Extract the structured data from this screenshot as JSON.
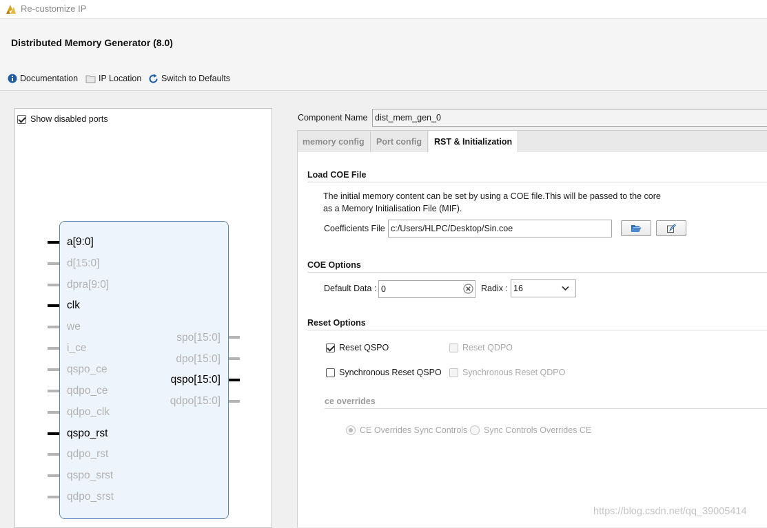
{
  "window": {
    "title": "Re-customize IP"
  },
  "header": {
    "ip_title": "Distributed Memory Generator (8.0)",
    "toolbar": {
      "documentation": "Documentation",
      "ip_location": "IP Location",
      "switch_defaults": "Switch to Defaults"
    }
  },
  "left_panel": {
    "show_disabled_ports": {
      "label": "Show disabled ports",
      "checked": true
    },
    "inputs": [
      {
        "name": "a[9:0]",
        "enabled": true
      },
      {
        "name": "d[15:0]",
        "enabled": false
      },
      {
        "name": "dpra[9:0]",
        "enabled": false
      },
      {
        "name": "clk",
        "enabled": true
      },
      {
        "name": "we",
        "enabled": false
      },
      {
        "name": "i_ce",
        "enabled": false
      },
      {
        "name": "qspo_ce",
        "enabled": false
      },
      {
        "name": "qdpo_ce",
        "enabled": false
      },
      {
        "name": "qdpo_clk",
        "enabled": false
      },
      {
        "name": "qspo_rst",
        "enabled": true
      },
      {
        "name": "qdpo_rst",
        "enabled": false
      },
      {
        "name": "qspo_srst",
        "enabled": false
      },
      {
        "name": "qdpo_srst",
        "enabled": false
      }
    ],
    "outputs": [
      {
        "name": "spo[15:0]",
        "enabled": false
      },
      {
        "name": "dpo[15:0]",
        "enabled": false
      },
      {
        "name": "qspo[15:0]",
        "enabled": true
      },
      {
        "name": "qdpo[15:0]",
        "enabled": false
      }
    ]
  },
  "component": {
    "label": "Component Name",
    "value": "dist_mem_gen_0"
  },
  "tabs": [
    {
      "label": "memory config",
      "active": false
    },
    {
      "label": "Port config",
      "active": false
    },
    {
      "label": "RST & Initialization",
      "active": true
    }
  ],
  "load_coe": {
    "title": "Load COE File",
    "desc_line1": "The initial memory content can be set by using a COE file.This will be passed to the core",
    "desc_line2": "as a Memory Initialisation File (MIF).",
    "coeff_label": "Coefficients File",
    "coeff_value": "c:/Users/HLPC/Desktop/Sin.coe"
  },
  "coe_options": {
    "title": "COE Options",
    "default_data_label": "Default Data :",
    "default_data_value": "0",
    "radix_label": "Radix :",
    "radix_value": "16"
  },
  "reset_options": {
    "title": "Reset Options",
    "reset_qspo": {
      "label": "Reset QSPO",
      "checked": true,
      "enabled": true
    },
    "reset_qdpo": {
      "label": "Reset QDPO",
      "checked": false,
      "enabled": false
    },
    "sync_reset_qspo": {
      "label": "Synchronous Reset QSPO",
      "checked": false,
      "enabled": true
    },
    "sync_reset_qdpo": {
      "label": "Synchronous Reset QDPO",
      "checked": false,
      "enabled": false
    },
    "ce_overrides": {
      "title": "ce overrides",
      "opt1": {
        "label": "CE Overrides Sync Controls",
        "selected": true
      },
      "opt2": {
        "label": "Sync Controls Overrides CE",
        "selected": false
      }
    }
  },
  "watermark": "https://blog.csdn.net/qq_39005414",
  "colors": {
    "block_fill": "#eef4fb",
    "block_border": "#5e86b4",
    "disabled_text": "#b2b2b2"
  },
  "icons": {
    "app": "vivado-logo-icon",
    "doc": "info-icon",
    "location": "folder-icon",
    "switch": "refresh-icon",
    "browse": "open-folder-icon",
    "edit": "edit-icon"
  }
}
